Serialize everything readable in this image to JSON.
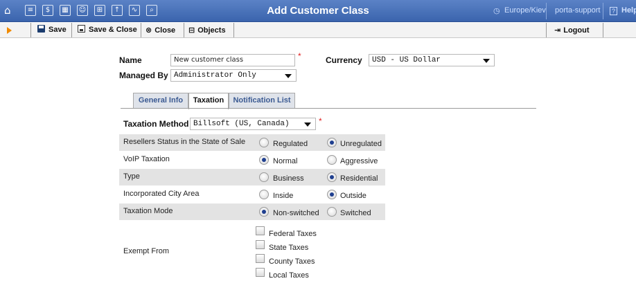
{
  "window": {
    "title": "Add Customer Class",
    "timezone": "Europe/Kiev",
    "user": "porta-support",
    "help_label": "Help"
  },
  "toolbar": {
    "save_label": "Save",
    "save_close_label": "Save & Close",
    "close_label": "Close",
    "objects_label": "Objects",
    "logout_label": "Logout"
  },
  "form": {
    "name_label": "Name",
    "name_value": "New customer class",
    "currency_label": "Currency",
    "currency_value": "USD - US Dollar",
    "managed_by_label": "Managed By",
    "managed_by_value": "Administrator Only",
    "required_mark": "*"
  },
  "tabs": [
    {
      "label": "General Info",
      "active": false
    },
    {
      "label": "Taxation",
      "active": true
    },
    {
      "label": "Notification List",
      "active": false
    }
  ],
  "taxation": {
    "method_label": "Taxation Method",
    "method_value": "Billsoft (US, Canada)",
    "rows": [
      {
        "label": "Resellers Status in the State of Sale",
        "opt1": "Regulated",
        "opt2": "Unregulated",
        "selected": 2
      },
      {
        "label": "VoIP Taxation",
        "opt1": "Normal",
        "opt2": "Aggressive",
        "selected": 1
      },
      {
        "label": "Type",
        "opt1": "Business",
        "opt2": "Residential",
        "selected": 2
      },
      {
        "label": "Incorporated City Area",
        "opt1": "Inside",
        "opt2": "Outside",
        "selected": 2
      },
      {
        "label": "Taxation Mode",
        "opt1": "Non-switched",
        "opt2": "Switched",
        "selected": 1
      }
    ],
    "exempt_label": "Exempt From",
    "exempt_options": [
      {
        "label": "Federal Taxes",
        "checked": false
      },
      {
        "label": "State Taxes",
        "checked": false
      },
      {
        "label": "County Taxes",
        "checked": false
      },
      {
        "label": "Local Taxes",
        "checked": false
      }
    ]
  }
}
